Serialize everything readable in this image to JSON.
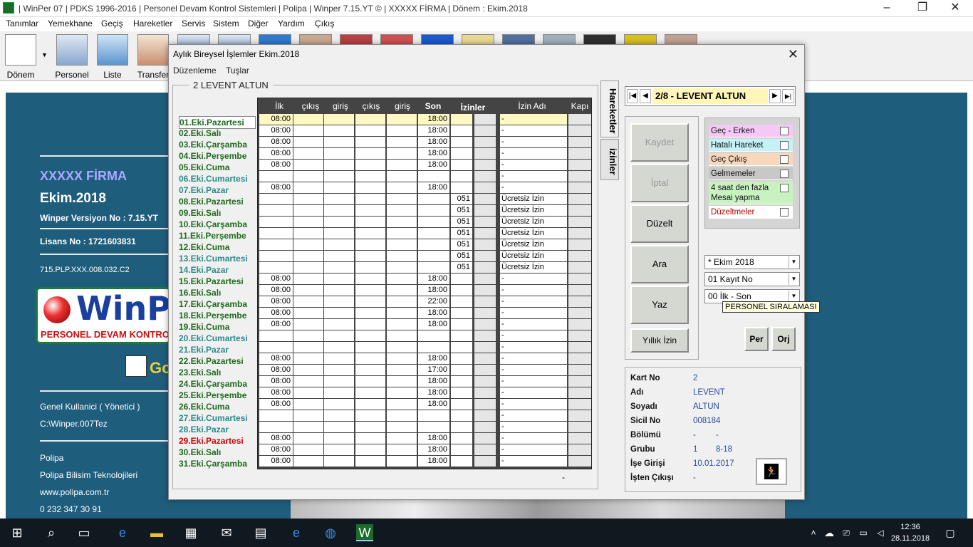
{
  "app": {
    "title": "|  WinPer 07  | PDKS 1996-2016 | Personel Devam Kontrol Sistemleri  |  Polipa  | Winper 7.15.YT  ©  |  XXXXX FİRMA |  Dönem : Ekim.2018",
    "menu": [
      "Tanımlar",
      "Yemekhane",
      "Geçiş",
      "Hareketler",
      "Servis",
      "Sistem",
      "Diğer",
      "Yardım",
      "Çıkış"
    ],
    "toolbar": [
      "Dönem",
      "Personel",
      "Liste",
      "Transfer"
    ],
    "minimize": "–",
    "maximize": "❐",
    "close": "✕"
  },
  "info": {
    "company": "XXXXX FİRMA",
    "period": "Ekim.2018",
    "version": "Winper Versiyon No : 7.15.YT",
    "license": "Lisans No : 1721603831",
    "code": "715.PLP.XXX.008.032.C2",
    "logo_text": "WinP",
    "logo_sub": "PERSONEL DEVAM KONTRO",
    "small_logo_text": "Go",
    "user": "Genel Kullanici ( Yönetici )",
    "path": "C:\\Winper.007Tez",
    "company2": "Polipa",
    "company3": "Polipa Bilisim Teknolojileri",
    "web": "www.polipa.com.tr",
    "phone": "0 232 347 30 91"
  },
  "dialog": {
    "title": "Aylık Bireysel İşlemler Ekim.2018",
    "close": "✕",
    "menu": [
      "Düzenleme",
      "Tuşlar"
    ],
    "employee_header": "2 LEVENT ALTUN",
    "tabs": [
      "Hareketler",
      "izinler"
    ],
    "columns": [
      "İlk",
      "çıkış",
      "giriş",
      "çıkış",
      "giriş",
      "Son",
      "İzinler",
      "",
      "İzin Adı",
      "Kapı"
    ],
    "footer_dash": "-",
    "colors": {
      "weekday": "#1c6b1c",
      "saturday": "#1c6b1c",
      "sunday": "#2a8a8a",
      "holiday": "#d00000"
    },
    "days": [
      {
        "label": "01.Eki.Pazartesi",
        "type": "weekday",
        "ilk": "08:00",
        "son": "18:00",
        "izin": "",
        "izin_adi": "-"
      },
      {
        "label": "02.Eki.Salı",
        "type": "weekday",
        "ilk": "08:00",
        "son": "18:00",
        "izin": "",
        "izin_adi": "-"
      },
      {
        "label": "03.Eki.Çarşamba",
        "type": "weekday",
        "ilk": "08:00",
        "son": "18:00",
        "izin": "",
        "izin_adi": "-"
      },
      {
        "label": "04.Eki.Perşembe",
        "type": "weekday",
        "ilk": "08:00",
        "son": "18:00",
        "izin": "",
        "izin_adi": "-"
      },
      {
        "label": "05.Eki.Cuma",
        "type": "weekday",
        "ilk": "08:00",
        "son": "18:00",
        "izin": "",
        "izin_adi": "-"
      },
      {
        "label": "06.Eki.Cumartesi",
        "type": "sunday",
        "ilk": "",
        "son": "",
        "izin": "",
        "izin_adi": "-"
      },
      {
        "label": "07.Eki.Pazar",
        "type": "sunday",
        "ilk": "08:00",
        "son": "18:00",
        "izin": "",
        "izin_adi": "-"
      },
      {
        "label": "08.Eki.Pazartesi",
        "type": "weekday",
        "ilk": "",
        "son": "",
        "izin": "051",
        "izin_adi": "Ücretsiz İzin"
      },
      {
        "label": "09.Eki.Salı",
        "type": "weekday",
        "ilk": "",
        "son": "",
        "izin": "051",
        "izin_adi": "Ücretsiz İzin"
      },
      {
        "label": "10.Eki.Çarşamba",
        "type": "weekday",
        "ilk": "",
        "son": "",
        "izin": "051",
        "izin_adi": "Ücretsiz İzin"
      },
      {
        "label": "11.Eki.Perşembe",
        "type": "weekday",
        "ilk": "",
        "son": "",
        "izin": "051",
        "izin_adi": "Ücretsiz İzin"
      },
      {
        "label": "12.Eki.Cuma",
        "type": "weekday",
        "ilk": "",
        "son": "",
        "izin": "051",
        "izin_adi": "Ücretsiz İzin"
      },
      {
        "label": "13.Eki.Cumartesi",
        "type": "sunday",
        "ilk": "",
        "son": "",
        "izin": "051",
        "izin_adi": "Ücretsiz İzin"
      },
      {
        "label": "14.Eki.Pazar",
        "type": "sunday",
        "ilk": "",
        "son": "",
        "izin": "051",
        "izin_adi": "Ücretsiz İzin"
      },
      {
        "label": "15.Eki.Pazartesi",
        "type": "weekday",
        "ilk": "08:00",
        "son": "18:00",
        "izin": "",
        "izin_adi": "-"
      },
      {
        "label": "16.Eki.Salı",
        "type": "weekday",
        "ilk": "08:00",
        "son": "18:00",
        "izin": "",
        "izin_adi": "-"
      },
      {
        "label": "17.Eki.Çarşamba",
        "type": "weekday",
        "ilk": "08:00",
        "son": "22:00",
        "izin": "",
        "izin_adi": "-"
      },
      {
        "label": "18.Eki.Perşembe",
        "type": "weekday",
        "ilk": "08:00",
        "son": "18:00",
        "izin": "",
        "izin_adi": "-"
      },
      {
        "label": "19.Eki.Cuma",
        "type": "weekday",
        "ilk": "08:00",
        "son": "18:00",
        "izin": "",
        "izin_adi": "-"
      },
      {
        "label": "20.Eki.Cumartesi",
        "type": "sunday",
        "ilk": "",
        "son": "",
        "izin": "",
        "izin_adi": "-"
      },
      {
        "label": "21.Eki.Pazar",
        "type": "sunday",
        "ilk": "",
        "son": "",
        "izin": "",
        "izin_adi": "-"
      },
      {
        "label": "22.Eki.Pazartesi",
        "type": "weekday",
        "ilk": "08:00",
        "son": "18:00",
        "izin": "",
        "izin_adi": "-"
      },
      {
        "label": "23.Eki.Salı",
        "type": "weekday",
        "ilk": "08:00",
        "son": "17:00",
        "izin": "",
        "izin_adi": "-"
      },
      {
        "label": "24.Eki.Çarşamba",
        "type": "weekday",
        "ilk": "08:00",
        "son": "18:00",
        "izin": "",
        "izin_adi": "-"
      },
      {
        "label": "25.Eki.Perşembe",
        "type": "weekday",
        "ilk": "08:00",
        "son": "18:00",
        "izin": "",
        "izin_adi": "-"
      },
      {
        "label": "26.Eki.Cuma",
        "type": "weekday",
        "ilk": "08:00",
        "son": "18:00",
        "izin": "",
        "izin_adi": "-"
      },
      {
        "label": "27.Eki.Cumartesi",
        "type": "sunday",
        "ilk": "",
        "son": "",
        "izin": "",
        "izin_adi": "-"
      },
      {
        "label": "28.Eki.Pazar",
        "type": "sunday",
        "ilk": "",
        "son": "",
        "izin": "",
        "izin_adi": "-"
      },
      {
        "label": "29.Eki.Pazartesi",
        "type": "holiday",
        "ilk": "08:00",
        "son": "18:00",
        "izin": "",
        "izin_adi": "-"
      },
      {
        "label": "30.Eki.Salı",
        "type": "weekday",
        "ilk": "08:00",
        "son": "18:00",
        "izin": "",
        "izin_adi": "-"
      },
      {
        "label": "31.Eki.Çarşamba",
        "type": "weekday",
        "ilk": "08:00",
        "son": "18:00",
        "izin": "",
        "izin_adi": "-"
      }
    ],
    "nav": {
      "label": "2/8 - LEVENT ALTUN",
      "first": "|◀",
      "prev": "◀",
      "next": "▶",
      "last": "▶|"
    },
    "buttons": {
      "kaydet": "Kaydet",
      "iptal": "İptal",
      "duzelt": "Düzelt",
      "ara": "Ara",
      "yaz": "Yaz",
      "yillik": "Yıllık İzin",
      "per": "Per",
      "orj": "Orj"
    },
    "filters": [
      {
        "label": "Geç - Erken",
        "color": "#f6c8f6",
        "text_color": "#111"
      },
      {
        "label": "Hatalı Hareket",
        "color": "#c4f2f6",
        "text_color": "#111"
      },
      {
        "label": "Geç Çıkış",
        "color": "#f8d8bc",
        "text_color": "#111"
      },
      {
        "label": "Gelmemeler",
        "color": "#c8c8c8",
        "text_color": "#111"
      },
      {
        "label": "4 saat den fazla Mesai yapma",
        "color": "#c8f2c0",
        "text_color": "#111"
      },
      {
        "label": "Düzeltmeler",
        "color": "#ffffff",
        "text_color": "#c00000"
      }
    ],
    "selects": {
      "donem": "* Ekim 2018",
      "kayit": "01  Kayıt No",
      "sira": "00 İlk - Son"
    },
    "tooltip": "PERSONEL SIRALAMASI",
    "details": [
      {
        "label": "Kart No",
        "value": "2",
        "value2": ""
      },
      {
        "label": "Adı",
        "value": "LEVENT",
        "value2": ""
      },
      {
        "label": "Soyadı",
        "value": "ALTUN",
        "value2": ""
      },
      {
        "label": "Sicil No",
        "value": "008184",
        "value2": ""
      },
      {
        "label": "Bölümü",
        "value": "-",
        "value2": "-"
      },
      {
        "label": "Grubu",
        "value": "1",
        "value2": "8-18"
      },
      {
        "label": "İşe Girişi",
        "value": "10.01.2017",
        "value2": ""
      },
      {
        "label": "İşten Çıkışı",
        "value": "-",
        "value2": ""
      }
    ]
  },
  "taskbar": {
    "time": "12:36",
    "date": "28.11.2018"
  }
}
